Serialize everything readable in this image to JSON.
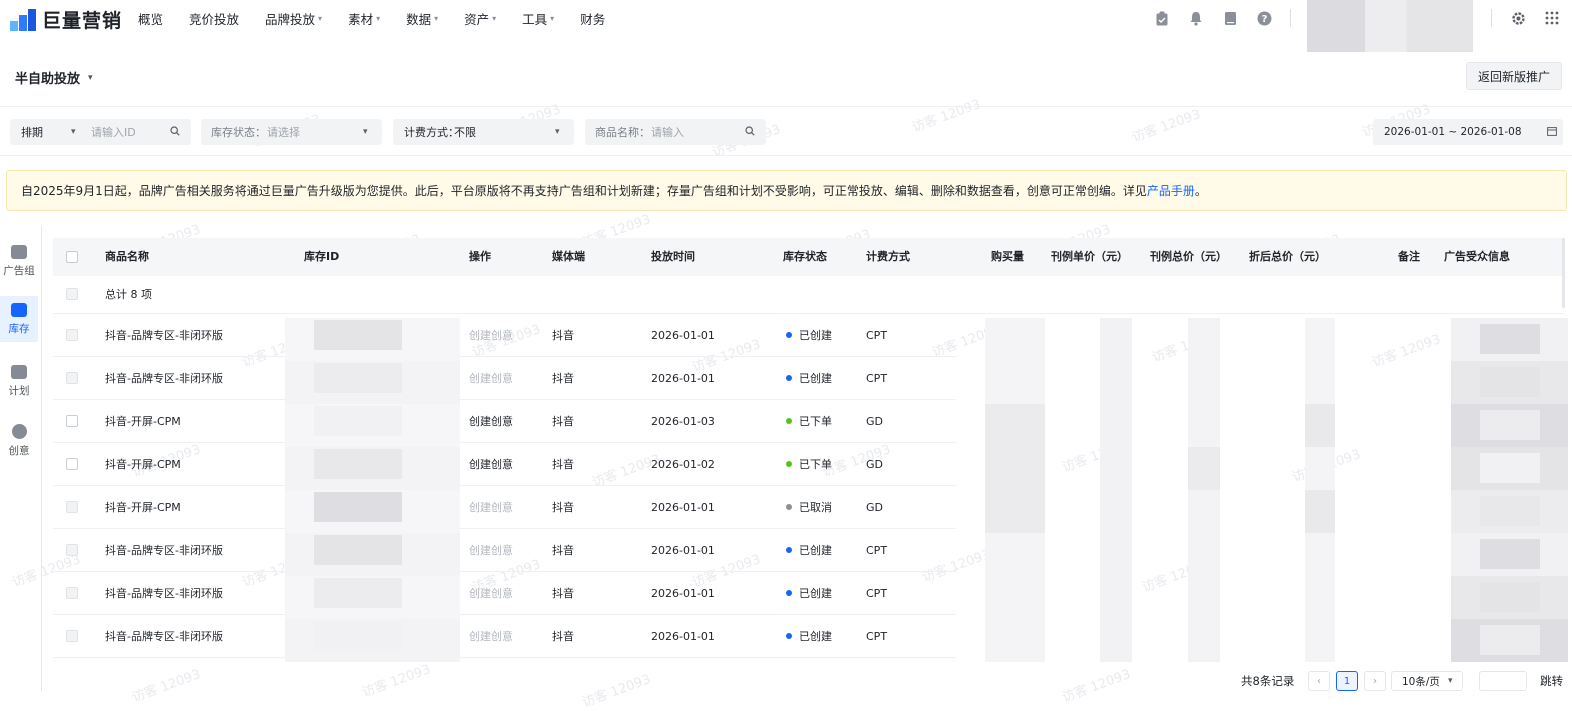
{
  "logo": {
    "text": "巨量营销"
  },
  "nav": [
    {
      "label": "概览",
      "caret": false
    },
    {
      "label": "竞价投放",
      "caret": false
    },
    {
      "label": "品牌投放",
      "caret": true
    },
    {
      "label": "素材",
      "caret": true
    },
    {
      "label": "数据",
      "caret": true
    },
    {
      "label": "资产",
      "caret": true
    },
    {
      "label": "工具",
      "caret": true
    },
    {
      "label": "财务",
      "caret": false
    }
  ],
  "top_icons": [
    "clipboard-icon",
    "bell-icon",
    "book-icon",
    "help-icon",
    "gear-icon",
    "apps-grid-icon"
  ],
  "subhead": {
    "mode": "半自助投放",
    "return_button": "返回新版推广"
  },
  "filters": {
    "schedule": {
      "label": "排期",
      "placeholder": "请输入ID"
    },
    "stock_status": {
      "label": "库存状态：",
      "placeholder": "请选择"
    },
    "billing": {
      "label": "计费方式：",
      "value": "不限"
    },
    "product": {
      "label": "商品名称：",
      "placeholder": "请输入"
    },
    "date_range": "2026-01-01 ~ 2026-01-08"
  },
  "notice": {
    "text": "自2025年9月1日起，品牌广告相关服务将通过巨量广告升级版为您提供。此后，平台原版将不再支持广告组和计划新建；存量广告组和计划不受影响，可正常投放、编辑、删除和数据查看，创意可正常创编。详见",
    "link": "产品手册",
    "suffix": "。"
  },
  "rail": [
    {
      "label": "广告组",
      "icon": "ad-group-icon",
      "active": false
    },
    {
      "label": "库存",
      "icon": "inventory-icon",
      "active": true
    },
    {
      "label": "计划",
      "icon": "plan-icon",
      "active": false
    },
    {
      "label": "创意",
      "icon": "creative-icon",
      "active": false
    }
  ],
  "table": {
    "columns": [
      "商品名称",
      "库存ID",
      "操作",
      "媒体端",
      "投放时间",
      "库存状态",
      "计费方式",
      "购买量",
      "刊例单价（元）",
      "刊例总价（元）",
      "折后总价（元）",
      "备注",
      "广告受众信息"
    ],
    "total_label": "总计 8 项",
    "rows": [
      {
        "name": "抖音-品牌专区-非闭环版",
        "action": "创建创意",
        "action_enabled": false,
        "media": "抖音",
        "date": "2026-01-01",
        "status": "已创建",
        "status_color": "#1664ff",
        "billing": "CPT"
      },
      {
        "name": "抖音-品牌专区-非闭环版",
        "action": "创建创意",
        "action_enabled": false,
        "media": "抖音",
        "date": "2026-01-01",
        "status": "已创建",
        "status_color": "#1664ff",
        "billing": "CPT"
      },
      {
        "name": "抖音-开屏-CPM",
        "action": "创建创意",
        "action_enabled": true,
        "media": "抖音",
        "date": "2026-01-03",
        "status": "已下单",
        "status_color": "#52c41a",
        "billing": "GD"
      },
      {
        "name": "抖音-开屏-CPM",
        "action": "创建创意",
        "action_enabled": true,
        "media": "抖音",
        "date": "2026-01-02",
        "status": "已下单",
        "status_color": "#52c41a",
        "billing": "GD"
      },
      {
        "name": "抖音-开屏-CPM",
        "action": "创建创意",
        "action_enabled": false,
        "media": "抖音",
        "date": "2026-01-01",
        "status": "已取消",
        "status_color": "#8a8f99",
        "billing": "GD"
      },
      {
        "name": "抖音-品牌专区-非闭环版",
        "action": "创建创意",
        "action_enabled": false,
        "media": "抖音",
        "date": "2026-01-01",
        "status": "已创建",
        "status_color": "#1664ff",
        "billing": "CPT"
      },
      {
        "name": "抖音-品牌专区-非闭环版",
        "action": "创建创意",
        "action_enabled": false,
        "media": "抖音",
        "date": "2026-01-01",
        "status": "已创建",
        "status_color": "#1664ff",
        "billing": "CPT"
      },
      {
        "name": "抖音-品牌专区-非闭环版",
        "action": "创建创意",
        "action_enabled": false,
        "media": "抖音",
        "date": "2026-01-01",
        "status": "已创建",
        "status_color": "#1664ff",
        "billing": "CPT"
      }
    ]
  },
  "pagination": {
    "total": "共8条记录",
    "current": "1",
    "page_size": "10条/页",
    "jump_label": "跳转"
  },
  "watermark": "访客 12093"
}
